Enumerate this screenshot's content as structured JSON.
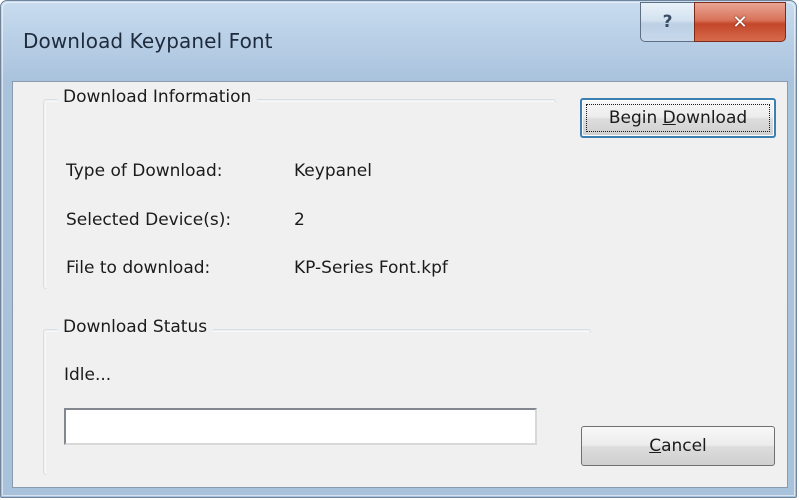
{
  "window": {
    "title": "Download Keypanel Font",
    "help_glyph": "?",
    "close_glyph": "✕"
  },
  "info_group": {
    "title": "Download Information",
    "rows": [
      {
        "label": "Type of Download:",
        "value": "Keypanel"
      },
      {
        "label": "Selected Device(s):",
        "value": "2"
      },
      {
        "label": "File to download:",
        "value": "KP-Series Font.kpf"
      }
    ]
  },
  "status_group": {
    "title": "Download Status",
    "status": "Idle...",
    "progress": 0
  },
  "buttons": {
    "begin_prefix": "Begin ",
    "begin_mnemonic": "D",
    "begin_rest": "ownload",
    "cancel_mnemonic": "C",
    "cancel_rest": "ancel"
  },
  "colors": {
    "titlebar": "#aac3dd",
    "client_bg": "#f0f0f0",
    "close_button": "#c4472a",
    "default_button_border": "#3c7fb1"
  }
}
